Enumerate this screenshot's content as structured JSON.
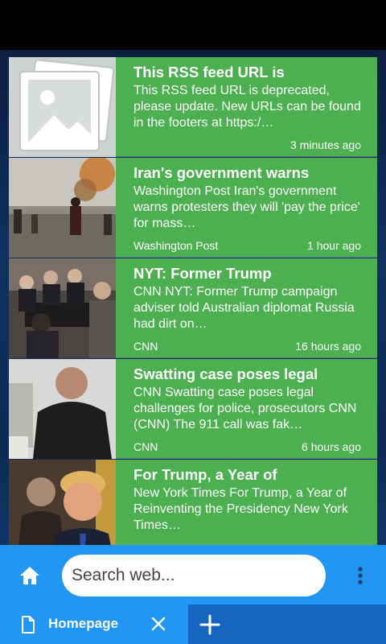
{
  "feed": {
    "items": [
      {
        "title": "This RSS feed URL is",
        "description": "This RSS feed URL is deprecated, please update. New URLs can be found in the footers at https:/…",
        "source": "",
        "time": "3 minutes ago",
        "thumbnail": "placeholder-image-icon"
      },
      {
        "title": "Iran's government warns",
        "description": "Washington Post Iran's government warns protesters they will 'pay the price' for mass…",
        "source": "Washington Post",
        "time": "1 hour ago",
        "thumbnail": "protest-photo"
      },
      {
        "title": "NYT: Former Trump",
        "description": "CNN NYT: Former Trump campaign adviser told Australian diplomat Russia had dirt on…",
        "source": "CNN",
        "time": "16 hours ago",
        "thumbnail": "meeting-photo"
      },
      {
        "title": "Swatting case poses legal",
        "description": "CNN Swatting case poses legal challenges for police, prosecutors CNN (CNN) The 911 call was fak…",
        "source": "CNN",
        "time": "6 hours ago",
        "thumbnail": "person-photo"
      },
      {
        "title": "For Trump, a Year of",
        "description": "New York Times For Trump, a Year of Reinventing the Presidency New York Times…",
        "source": "",
        "time": "",
        "thumbnail": "portrait-photo"
      }
    ]
  },
  "toolbar": {
    "home_icon": "home-icon",
    "search_placeholder": "Search web...",
    "menu_icon": "more-vert-icon"
  },
  "tabs": {
    "current_label": "Homepage",
    "close_icon": "close-icon",
    "new_tab_icon": "plus-icon"
  },
  "colors": {
    "card_green": "#4caf50",
    "toolbar_blue": "#2196f3",
    "tabbar_blue": "#1565c0"
  }
}
